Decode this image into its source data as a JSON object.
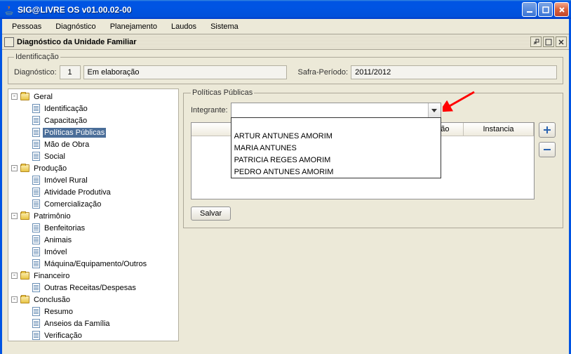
{
  "window": {
    "title": "SIG@LIVRE OS v01.00.02-00"
  },
  "menu": [
    "Pessoas",
    "Diagnóstico",
    "Planejamento",
    "Laudos",
    "Sistema"
  ],
  "internal_window": {
    "title": "Diagnóstico da Unidade Familiar"
  },
  "ident": {
    "legend": "Identificação",
    "diag_label": "Diagnóstico:",
    "diag_value": "1",
    "status_value": "Em elaboração",
    "safra_label": "Safra-Período:",
    "safra_value": "2011/2012"
  },
  "tree": [
    {
      "label": "Geral",
      "type": "folder",
      "expanded": true,
      "children": [
        {
          "label": "Identificação",
          "type": "leaf"
        },
        {
          "label": "Capacitação",
          "type": "leaf"
        },
        {
          "label": "Políticas Públicas",
          "type": "leaf",
          "selected": true
        },
        {
          "label": "Mão de Obra",
          "type": "leaf"
        },
        {
          "label": "Social",
          "type": "leaf"
        }
      ]
    },
    {
      "label": "Produção",
      "type": "folder",
      "expanded": true,
      "children": [
        {
          "label": "Imóvel Rural",
          "type": "leaf"
        },
        {
          "label": "Atividade Produtiva",
          "type": "leaf"
        },
        {
          "label": "Comercialização",
          "type": "leaf"
        }
      ]
    },
    {
      "label": "Patrimônio",
      "type": "folder",
      "expanded": true,
      "children": [
        {
          "label": "Benfeitorias",
          "type": "leaf"
        },
        {
          "label": "Animais",
          "type": "leaf"
        },
        {
          "label": "Imóvel",
          "type": "leaf"
        },
        {
          "label": "Máquina/Equipamento/Outros",
          "type": "leaf"
        }
      ]
    },
    {
      "label": "Financeiro",
      "type": "folder",
      "expanded": true,
      "children": [
        {
          "label": "Outras Receitas/Despesas",
          "type": "leaf"
        }
      ]
    },
    {
      "label": "Conclusão",
      "type": "folder",
      "expanded": true,
      "children": [
        {
          "label": "Resumo",
          "type": "leaf"
        },
        {
          "label": "Anseios da Família",
          "type": "leaf"
        },
        {
          "label": "Verificação",
          "type": "leaf"
        }
      ]
    }
  ],
  "panel": {
    "legend": "Políticas Públicas",
    "integ_label": "Integrante:",
    "combo_value": "",
    "combo_options": [
      "",
      "ARTUR ANTUNES AMORIM",
      "MARIA ANTUNES",
      "PATRICIA REGES AMORIM",
      "PEDRO ANTUNES AMORIM"
    ],
    "columns": [
      "",
      "desão",
      "Instancia"
    ],
    "save_label": "Salvar",
    "add_icon": "plus-icon",
    "remove_icon": "minus-icon"
  }
}
